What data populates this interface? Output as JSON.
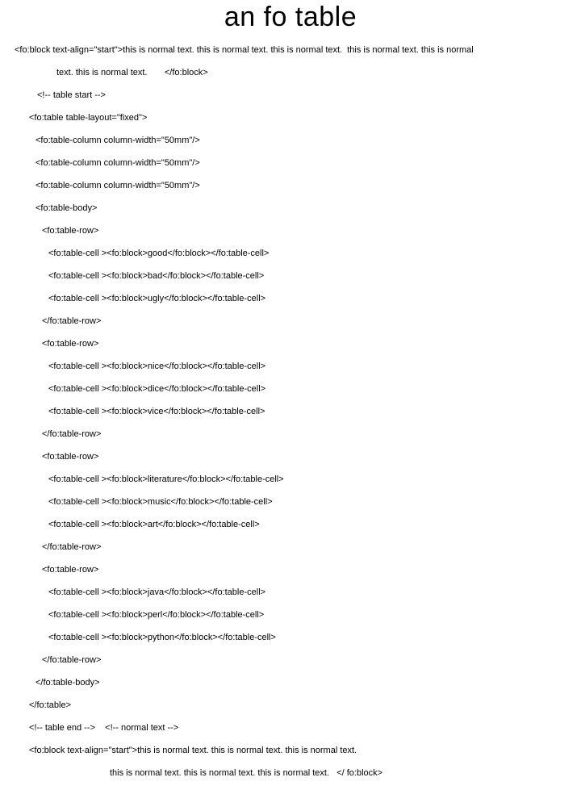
{
  "heading": "an fo table",
  "lines": {
    "l1": "<fo:block text-align=\"start\">this is normal text. this is normal text. this is normal text.  this is normal text. this is normal",
    "l1b": "text. this is normal text.       </fo:block>",
    "l2": "<!-- table start -->",
    "l3": "<fo:table table-layout=\"fixed\">",
    "l4": "<fo:table-column column-width=\"50mm\"/>",
    "l5": "<fo:table-column column-width=\"50mm\"/>",
    "l6": "<fo:table-column column-width=\"50mm\"/>",
    "l7": "<fo:table-body>",
    "l8": "<fo:table-row>",
    "l9": "<fo:table-cell ><fo:block>good</fo:block></fo:table-cell>",
    "l10": "<fo:table-cell ><fo:block>bad</fo:block></fo:table-cell>",
    "l11": "<fo:table-cell ><fo:block>ugly</fo:block></fo:table-cell>",
    "l12": "</fo:table-row>",
    "l13": "<fo:table-row>",
    "l14": "<fo:table-cell ><fo:block>nice</fo:block></fo:table-cell>",
    "l15": "<fo:table-cell ><fo:block>dice</fo:block></fo:table-cell>",
    "l16": "<fo:table-cell ><fo:block>vice</fo:block></fo:table-cell>",
    "l17": "</fo:table-row>",
    "l18": "<fo:table-row>",
    "l19": "<fo:table-cell ><fo:block>literature</fo:block></fo:table-cell>",
    "l20": "<fo:table-cell ><fo:block>music</fo:block></fo:table-cell>",
    "l21": "<fo:table-cell ><fo:block>art</fo:block></fo:table-cell>",
    "l22": "</fo:table-row>",
    "l23": "<fo:table-row>",
    "l24": "<fo:table-cell ><fo:block>java</fo:block></fo:table-cell>",
    "l25": "<fo:table-cell ><fo:block>perl</fo:block></fo:table-cell>",
    "l26": "<fo:table-cell ><fo:block>python</fo:block></fo:table-cell>",
    "l27": "</fo:table-row>",
    "l28": "</fo:table-body>",
    "l29": "</fo:table>",
    "l30": "<!-- table end -->    <!-- normal text -->",
    "l31": "<fo:block text-align=\"start\">this is normal text. this is normal text. this is normal text.",
    "l32": "this is normal text. this is normal text. this is normal text.   </ fo:block>"
  }
}
